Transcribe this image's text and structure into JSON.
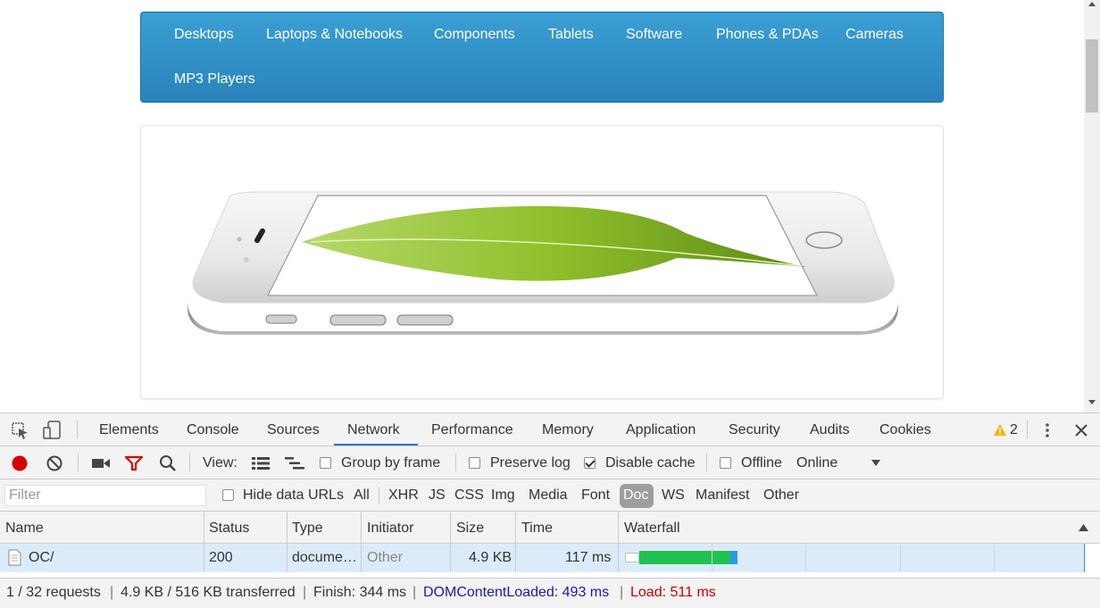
{
  "menu": {
    "items": [
      "Desktops",
      "Laptops & Notebooks",
      "Components",
      "Tablets",
      "Software",
      "Phones & PDAs",
      "Cameras",
      "MP3 Players"
    ]
  },
  "devtools": {
    "tabs": [
      "Elements",
      "Console",
      "Sources",
      "Network",
      "Performance",
      "Memory",
      "Application",
      "Security",
      "Audits",
      "Cookies"
    ],
    "active_tab": "Network",
    "warning_count": "2",
    "toolbar": {
      "view_label": "View:",
      "group_by_frame": "Group by frame",
      "preserve_log": "Preserve log",
      "disable_cache": "Disable cache",
      "offline": "Offline",
      "throttle_value": "Online"
    },
    "filter": {
      "placeholder": "Filter",
      "hide_data_urls": "Hide data URLs",
      "types": [
        "All",
        "XHR",
        "JS",
        "CSS",
        "Img",
        "Media",
        "Font",
        "Doc",
        "WS",
        "Manifest",
        "Other"
      ],
      "selected_type": "Doc"
    },
    "table": {
      "headers": [
        "Name",
        "Status",
        "Type",
        "Initiator",
        "Size",
        "Time",
        "Waterfall"
      ],
      "rows": [
        {
          "name": "OC/",
          "status": "200",
          "type": "docume…",
          "initiator": "Other",
          "size": "4.9 KB",
          "time": "117 ms"
        }
      ]
    },
    "status": {
      "requests": "1 / 32 requests",
      "transferred": "4.9 KB / 516 KB transferred",
      "finish": "Finish: 344 ms",
      "dom_content_loaded": "DOMContentLoaded: 493 ms",
      "load": "Load: 511 ms"
    },
    "colors": {
      "dcl": "#1a1aa6",
      "load": "#c80000",
      "record": "#d50000",
      "filter_icon": "#d50000",
      "waterfall_green": "#21c152",
      "waterfall_blue": "#2d9ae8"
    }
  }
}
